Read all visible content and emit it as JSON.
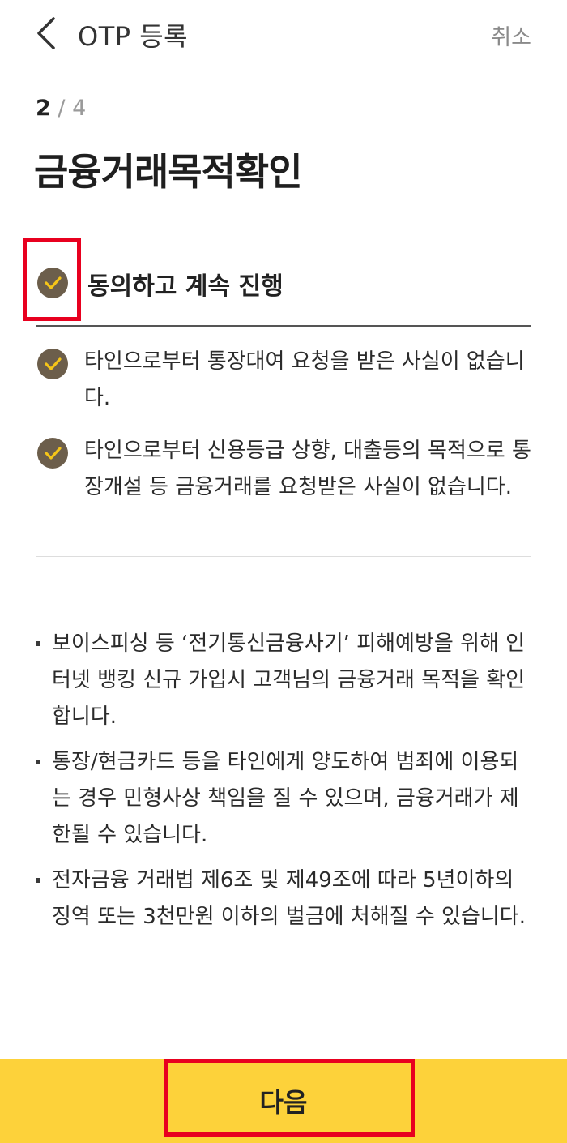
{
  "header": {
    "title": "OTP 등록",
    "cancel_label": "취소"
  },
  "step": {
    "current": "2",
    "separator": "/",
    "total": "4"
  },
  "page_title": "금융거래목적확인",
  "agree_all": {
    "label": "동의하고 계속 진행",
    "checked": true
  },
  "confirm_items": [
    {
      "text": "타인으로부터 통장대여 요청을 받은 사실이 없습니다.",
      "checked": true
    },
    {
      "text": "타인으로부터 신용등급 상향, 대출등의 목적으로 통장개설 등 금융거래를 요청받은 사실이 없습니다.",
      "checked": true
    }
  ],
  "notices": [
    "보이스피싱 등 ‘전기통신금융사기’ 피해예방을 위해 인터넷 뱅킹 신규 가입시 고객님의 금융거래 목적을 확인합니다.",
    "통장/현금카드 등을 타인에게 양도하여 범죄에 이용되는 경우 민형사상 책임을 질 수 있으며, 금융거래가 제한될 수 있습니다.",
    "전자금융 거래법 제6조 및 제49조에 따라 5년이하의 징역 또는 3천만원 이하의 벌금에 처해질 수 있습니다."
  ],
  "next_label": "다음",
  "colors": {
    "accent_yellow": "#fdd23a",
    "check_bg": "#6c5e4b",
    "check_mark": "#f5c518",
    "highlight_red": "#e8001f"
  }
}
